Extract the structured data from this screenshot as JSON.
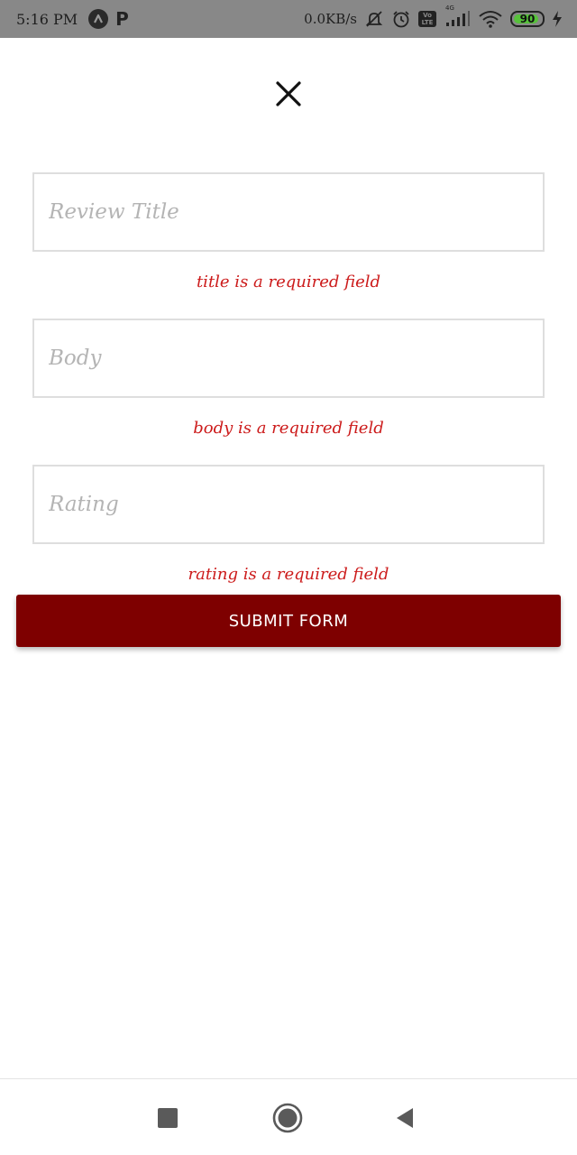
{
  "status_bar": {
    "time": "5:16 PM",
    "speed": "0.0KB/s",
    "network_label": "4G",
    "volte_top": "Vo",
    "volte_bottom": "LTE",
    "battery_level": "90",
    "battery_percent": 90,
    "icons": [
      "nav-arrow-icon",
      "parking-icon",
      "mute-bell-icon",
      "alarm-icon",
      "volte-icon",
      "signal-icon",
      "wifi-icon",
      "battery-icon",
      "charging-icon"
    ]
  },
  "form": {
    "close_icon": "close-icon",
    "fields": {
      "title": {
        "placeholder": "Review Title",
        "value": "",
        "error": "title is a required field"
      },
      "body": {
        "placeholder": "Body",
        "value": "",
        "error": "body is a required field"
      },
      "rating": {
        "placeholder": "Rating",
        "value": "",
        "error": "rating is a required field"
      }
    },
    "submit_label": "SUBMIT FORM"
  },
  "nav_bar": {
    "icons": [
      "recents-square-icon",
      "home-circle-icon",
      "back-triangle-icon"
    ]
  },
  "colors": {
    "accent": "#7e0000",
    "error": "#cc1b1b",
    "status_bar": "#888888",
    "battery": "#56c23a"
  }
}
